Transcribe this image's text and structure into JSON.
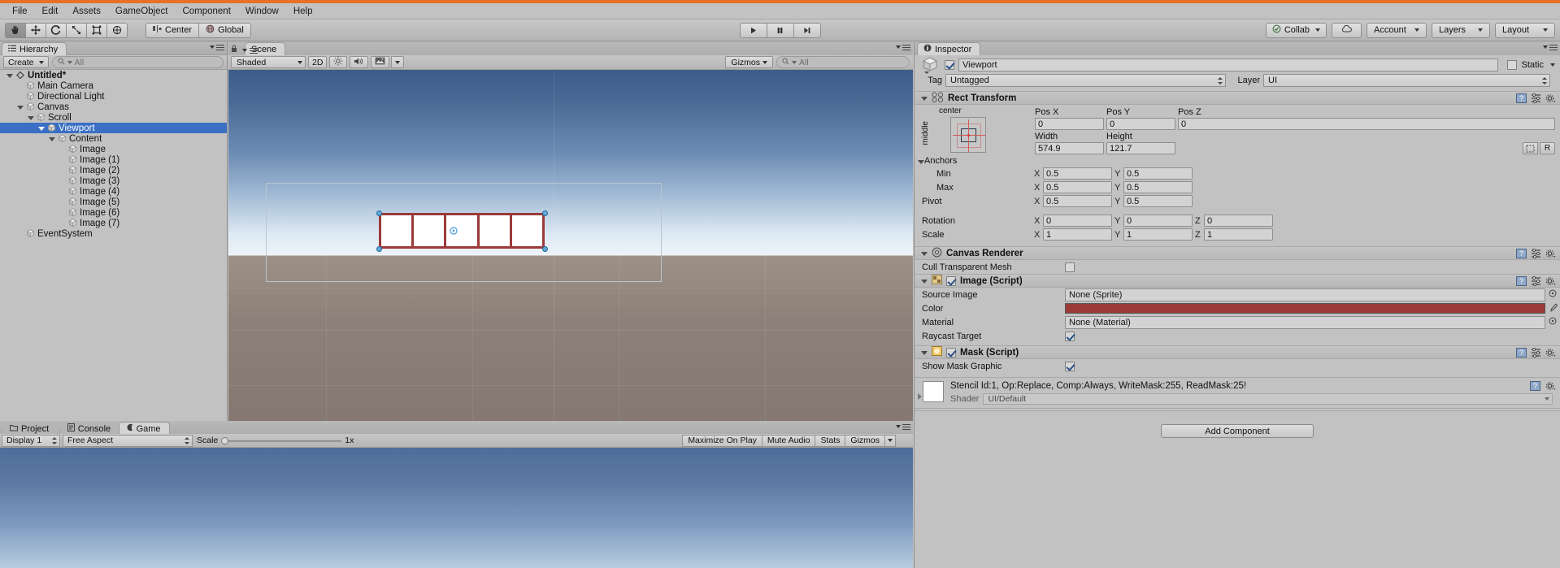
{
  "menu": {
    "items": [
      "File",
      "Edit",
      "Assets",
      "GameObject",
      "Component",
      "Window",
      "Help"
    ]
  },
  "toolbar": {
    "transform_tools": [
      "hand-tool",
      "move-tool",
      "rotate-tool",
      "scale-tool",
      "rect-tool",
      "transform-tool"
    ],
    "pivot_mode": "Center",
    "pivot_rotation": "Global",
    "play": "play-icon",
    "pause": "pause-icon",
    "step": "step-icon",
    "collab": "Collab",
    "cloud": "cloud-icon",
    "account": "Account",
    "layers": "Layers",
    "layout": "Layout"
  },
  "hierarchy": {
    "tab": "Hierarchy",
    "create_label": "Create",
    "search_placeholder": "All",
    "items": [
      {
        "label": "Untitled*",
        "depth": 0,
        "expanded": true,
        "selected": false,
        "scene": true
      },
      {
        "label": "Main Camera",
        "depth": 1,
        "expanded": false,
        "selected": false
      },
      {
        "label": "Directional Light",
        "depth": 1,
        "expanded": false,
        "selected": false
      },
      {
        "label": "Canvas",
        "depth": 1,
        "expanded": true,
        "selected": false
      },
      {
        "label": "Scroll",
        "depth": 2,
        "expanded": true,
        "selected": false
      },
      {
        "label": "Viewport",
        "depth": 3,
        "expanded": true,
        "selected": true
      },
      {
        "label": "Content",
        "depth": 4,
        "expanded": true,
        "selected": false
      },
      {
        "label": "Image",
        "depth": 5,
        "expanded": false,
        "selected": false
      },
      {
        "label": "Image (1)",
        "depth": 5,
        "expanded": false,
        "selected": false
      },
      {
        "label": "Image (2)",
        "depth": 5,
        "expanded": false,
        "selected": false
      },
      {
        "label": "Image (3)",
        "depth": 5,
        "expanded": false,
        "selected": false
      },
      {
        "label": "Image (4)",
        "depth": 5,
        "expanded": false,
        "selected": false
      },
      {
        "label": "Image (5)",
        "depth": 5,
        "expanded": false,
        "selected": false
      },
      {
        "label": "Image (6)",
        "depth": 5,
        "expanded": false,
        "selected": false
      },
      {
        "label": "Image (7)",
        "depth": 5,
        "expanded": false,
        "selected": false
      },
      {
        "label": "EventSystem",
        "depth": 1,
        "expanded": false,
        "selected": false
      }
    ]
  },
  "scene": {
    "tab": "Scene",
    "draw_mode": "Shaded",
    "mode_2d": "2D",
    "lighting_icon": "sun-icon",
    "audio_icon": "speaker-icon",
    "fx_icon": "image-fx-icon",
    "gizmos_label": "Gizmos",
    "search_placeholder": "All"
  },
  "bottom_panel": {
    "tabs": [
      {
        "label": "Project",
        "active": false,
        "icon": "folder-icon"
      },
      {
        "label": "Console",
        "active": false,
        "icon": "console-icon"
      },
      {
        "label": "Game",
        "active": true,
        "icon": "game-icon"
      }
    ],
    "display": "Display 1",
    "aspect": "Free Aspect",
    "scale_label": "Scale",
    "scale_value": "1x",
    "maximize_on_play": "Maximize On Play",
    "mute_audio": "Mute Audio",
    "stats": "Stats",
    "gizmos": "Gizmos"
  },
  "inspector": {
    "tab": "Inspector",
    "object_name": "Viewport",
    "object_enabled": true,
    "static_label": "Static",
    "static_checked": false,
    "tag_label": "Tag",
    "tag_value": "Untagged",
    "layer_label": "Layer",
    "layer_value": "UI",
    "rect_transform": {
      "title": "Rect Transform",
      "anchor_preset_h": "center",
      "anchor_preset_v": "middle",
      "pos_labels": [
        "Pos X",
        "Pos Y",
        "Pos Z"
      ],
      "pos_values": [
        "0",
        "0",
        "0"
      ],
      "size_labels": [
        "Width",
        "Height"
      ],
      "size_values": [
        "574.9",
        "121.7"
      ],
      "blueprint_icon": "blueprint-icon",
      "raw_label": "R",
      "anchors_label": "Anchors",
      "min_label": "Min",
      "min_values": [
        "0.5",
        "0.5"
      ],
      "max_label": "Max",
      "max_values": [
        "0.5",
        "0.5"
      ],
      "pivot_label": "Pivot",
      "pivot_values": [
        "0.5",
        "0.5"
      ],
      "rotation_label": "Rotation",
      "rotation_values": [
        "0",
        "0",
        "0"
      ],
      "scale_label": "Scale",
      "scale_values": [
        "1",
        "1",
        "1"
      ],
      "axes": [
        "X",
        "Y",
        "Z"
      ]
    },
    "canvas_renderer": {
      "title": "Canvas Renderer",
      "cull_label": "Cull Transparent Mesh",
      "cull_checked": false
    },
    "image_script": {
      "title": "Image (Script)",
      "enabled": true,
      "source_image_label": "Source Image",
      "source_image_value": "None (Sprite)",
      "color_label": "Color",
      "color_value": "#9C3A3A",
      "material_label": "Material",
      "material_value": "None (Material)",
      "raycast_label": "Raycast Target",
      "raycast_checked": true
    },
    "mask_script": {
      "title": "Mask (Script)",
      "enabled": true,
      "show_mask_label": "Show Mask Graphic",
      "show_mask_checked": true
    },
    "material_block": {
      "stencil_text": "Stencil Id:1, Op:Replace, Comp:Always, WriteMask:255, ReadMask:25!",
      "shader_label": "Shader",
      "shader_value": "UI/Default"
    },
    "add_component": "Add Component"
  }
}
